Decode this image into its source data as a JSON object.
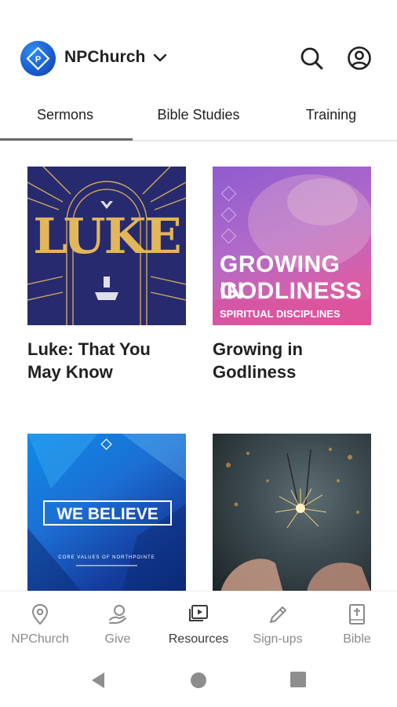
{
  "header": {
    "church_name": "NPChurch",
    "logo_icon": "npchurch-logo-icon",
    "dropdown_icon": "chevron-down-icon",
    "search_icon": "search-icon",
    "account_icon": "account-circle-icon"
  },
  "tabs": [
    {
      "label": "Sermons",
      "active": true
    },
    {
      "label": "Bible Studies",
      "active": false
    },
    {
      "label": "Training",
      "active": false
    }
  ],
  "cards": [
    {
      "title": "Luke: That You May Know",
      "art_text": "LUKE"
    },
    {
      "title": "Growing in Godliness",
      "art_line1": "GROWING IN",
      "art_line2": "GODLINESS",
      "art_sub": "SPIRITUAL DISCIPLINES"
    },
    {
      "title": "",
      "art_text": "WE BELIEVE",
      "art_sub": "CORE VALUES OF NORTHPOINTE"
    },
    {
      "title": ""
    }
  ],
  "bottom_nav": [
    {
      "label": "NPChurch",
      "icon": "location-pin-icon",
      "active": false
    },
    {
      "label": "Give",
      "icon": "give-hand-icon",
      "active": false
    },
    {
      "label": "Resources",
      "icon": "media-library-icon",
      "active": true
    },
    {
      "label": "Sign-ups",
      "icon": "pencil-icon",
      "active": false
    },
    {
      "label": "Bible",
      "icon": "bible-book-icon",
      "active": false
    }
  ],
  "colors": {
    "accent_blue": "#1a5fd1",
    "luke_gold": "#e2b65a",
    "luke_navy": "#272a6e"
  }
}
